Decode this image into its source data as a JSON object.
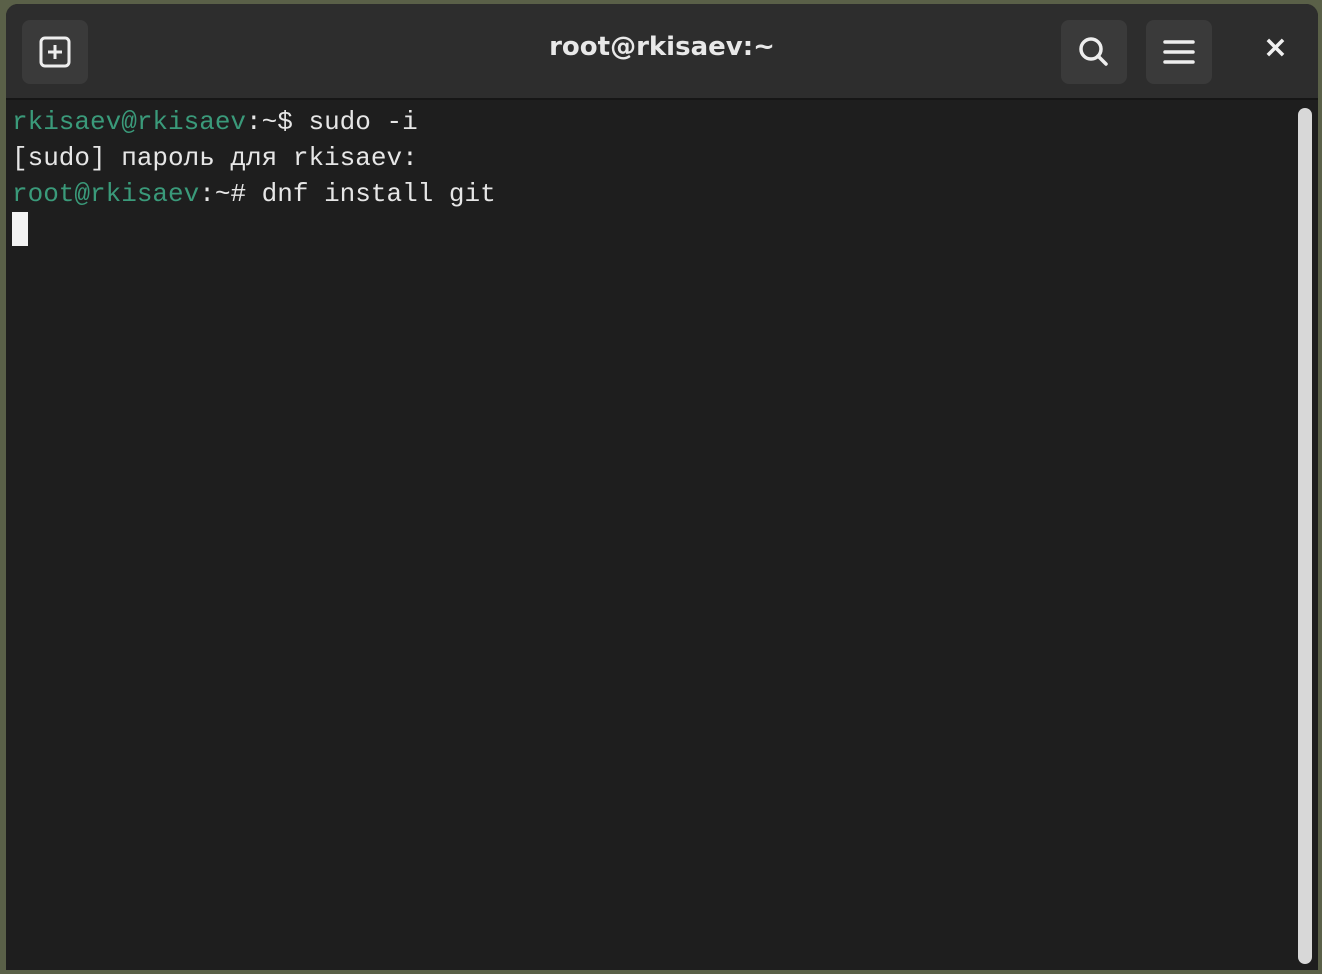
{
  "window": {
    "title": "root@rkisaev:~"
  },
  "header": {
    "new_tab_icon": "plus-square-icon",
    "search_icon": "search-icon",
    "menu_icon": "hamburger-icon",
    "close_label": "×"
  },
  "terminal": {
    "lines": [
      {
        "prompt": "rkisaev@rkisaev",
        "sep": ":~$ ",
        "command": "sudo -i"
      },
      {
        "text": "[sudo] пароль для rkisaev:"
      },
      {
        "prompt": "root@rkisaev",
        "sep": ":~# ",
        "command": "dnf install git"
      }
    ]
  },
  "colors": {
    "prompt": "#3a9a7a",
    "background": "#1e1e1e",
    "header": "#2d2d2d"
  }
}
